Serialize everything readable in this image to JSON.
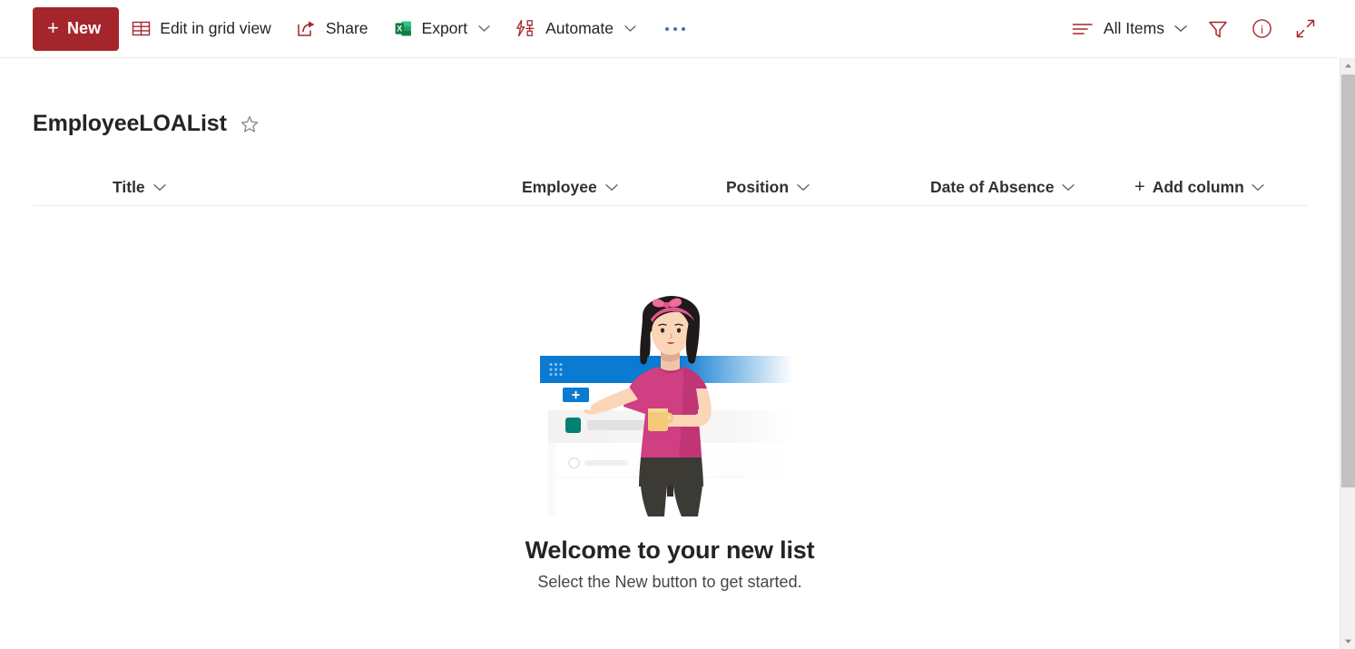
{
  "commandbar": {
    "new_label": "New",
    "edit_grid_label": "Edit in grid view",
    "share_label": "Share",
    "export_label": "Export",
    "automate_label": "Automate",
    "overflow_label": "···",
    "view_label": "All Items",
    "icons": {
      "new": "plus-icon",
      "edit_grid": "grid-table-icon",
      "share": "share-arrow-icon",
      "export": "excel-icon",
      "export_letter": "X",
      "automate": "automate-flow-icon",
      "overflow": "more-horizontal-icon",
      "view_list": "view-list-icon",
      "filter": "filter-funnel-icon",
      "info": "info-circle-icon",
      "info_letter": "i",
      "expand": "expand-diagonal-icon",
      "chevron": "chevron-down-icon"
    }
  },
  "header": {
    "list_title": "EmployeeLOAList",
    "favorite_icon": "star-outline-icon"
  },
  "columns": [
    {
      "label": "Title",
      "icon": "chevron-down-icon"
    },
    {
      "label": "Employee",
      "icon": "chevron-down-icon"
    },
    {
      "label": "Position",
      "icon": "chevron-down-icon"
    },
    {
      "label": "Date of Absence",
      "icon": "chevron-down-icon"
    },
    {
      "label": "Add column",
      "icon": "chevron-down-icon",
      "prefix": "+"
    }
  ],
  "empty_state": {
    "illustration": "woman-with-mug-and-list-app-illustration",
    "title": "Welcome to your new list",
    "subtitle": "Select the New button to get started."
  },
  "scrollbar": {
    "up_icon": "scroll-up-arrow-icon",
    "down_icon": "scroll-down-arrow-icon",
    "thumb": "scroll-thumb"
  },
  "colors": {
    "accent_red": "#a4262c",
    "excel_green": "#107c41",
    "illustration_blue": "#0b7ad1",
    "illustration_pink": "#d4437f",
    "illustration_teal": "#008272",
    "text_primary": "#242424",
    "text_secondary": "#484644",
    "divider": "#edebe9"
  }
}
